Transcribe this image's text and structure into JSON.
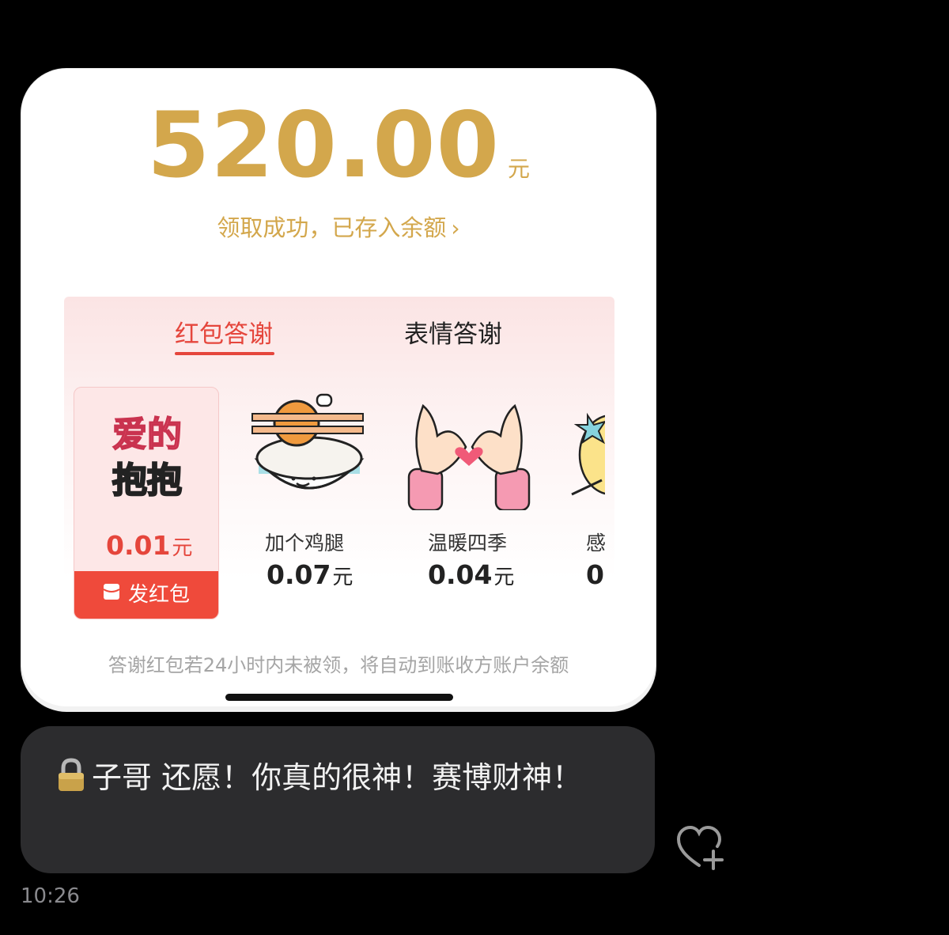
{
  "red_packet": {
    "amount": "520.00",
    "unit": "元",
    "status": "领取成功，已存入余额",
    "status_chevron": "›",
    "tabs": [
      {
        "label": "红包答谢",
        "active": true
      },
      {
        "label": "表情答谢",
        "active": false
      }
    ],
    "gifts": [
      {
        "title_line1": "爱的",
        "title_line2": "抱抱",
        "name": "",
        "price": "0.01",
        "unit": "元",
        "selected": true,
        "icon": "love-hug-sticker"
      },
      {
        "name": "加个鸡腿",
        "price": "0.07",
        "unit": "元",
        "selected": false,
        "icon": "rice-bowl-drumstick"
      },
      {
        "name": "温暖四季",
        "price": "0.04",
        "unit": "元",
        "selected": false,
        "icon": "heart-hands"
      },
      {
        "name": "感",
        "price": "0",
        "unit": "",
        "selected": false,
        "icon": "partial-sticker"
      }
    ],
    "send_button": "发红包",
    "note": "答谢红包若24小时内未被领，将自动到账收方账户余额"
  },
  "message": {
    "text": "子哥 还愿！你真的很神！赛博财神！",
    "lock_icon": "lock-icon",
    "time": "10:26"
  },
  "colors": {
    "gold": "#d3a74c",
    "red": "#e5463c",
    "button_red": "#ef4a3b",
    "bubble": "#2c2c2e",
    "background": "#000000"
  }
}
